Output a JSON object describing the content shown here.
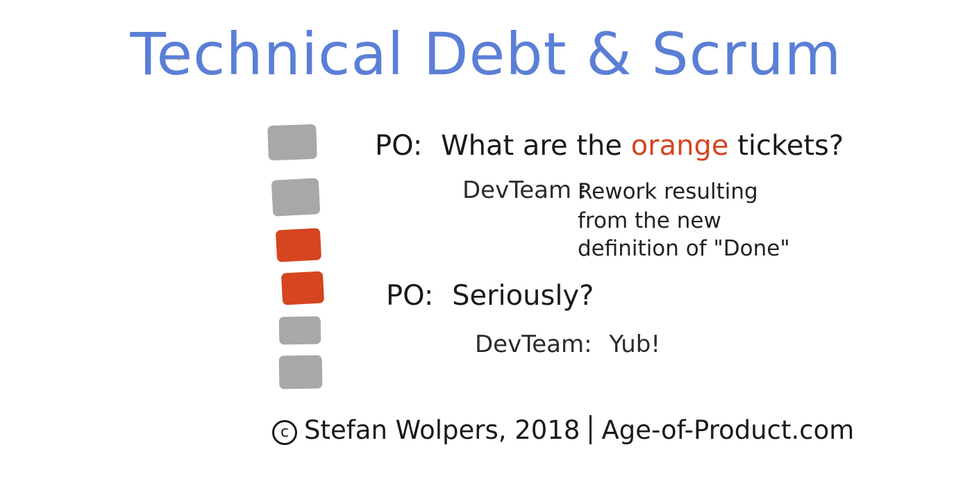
{
  "title": "Technical Debt & Scrum",
  "colors": {
    "title": "#5b7fd6",
    "ticket_gray": "#a8a8a8",
    "ticket_orange": "#d44520",
    "ink": "#1a1a1a"
  },
  "tickets": [
    {
      "color": "gray"
    },
    {
      "color": "gray"
    },
    {
      "color": "orange"
    },
    {
      "color": "orange"
    },
    {
      "color": "gray"
    },
    {
      "color": "gray"
    }
  ],
  "dialogue": {
    "q1": {
      "speaker": "PO",
      "before": "What are the",
      "highlight": "orange",
      "after": "tickets?"
    },
    "a1": {
      "speaker": "DevTeam",
      "lines": [
        "Rework resulting",
        "from the new",
        "definition of \"Done\""
      ]
    },
    "q2": {
      "speaker": "PO",
      "text": "Seriously?"
    },
    "a2": {
      "speaker": "DevTeam",
      "text": "Yub!"
    }
  },
  "footer": {
    "copyright_symbol": "c",
    "author": "Stefan Wolpers, 2018",
    "site": "Age-of-Product.com"
  }
}
